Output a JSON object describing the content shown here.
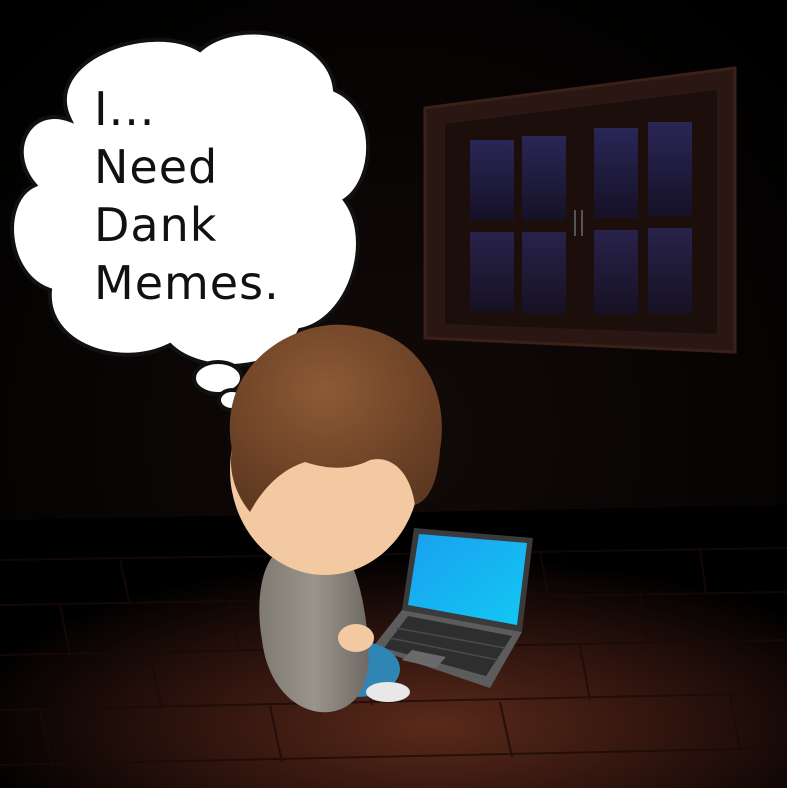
{
  "thought_bubble": {
    "lines": [
      "I...",
      "Need",
      "Dank",
      "Memes."
    ]
  },
  "colors": {
    "background": "#000000",
    "floor": "#3a1a12",
    "window_frame": "#2a1612",
    "window_glass": "#1c1a3c",
    "hair": "#7a4a2c",
    "skin": "#f2c9a0",
    "hoodie": "#8d8880",
    "jeans": "#2f86b4",
    "laptop_screen": "#1ea2ee",
    "laptop_body": "#5c5c5c"
  },
  "icons": {
    "character": "person-sitting-icon",
    "device": "laptop-icon",
    "window": "window-icon"
  }
}
